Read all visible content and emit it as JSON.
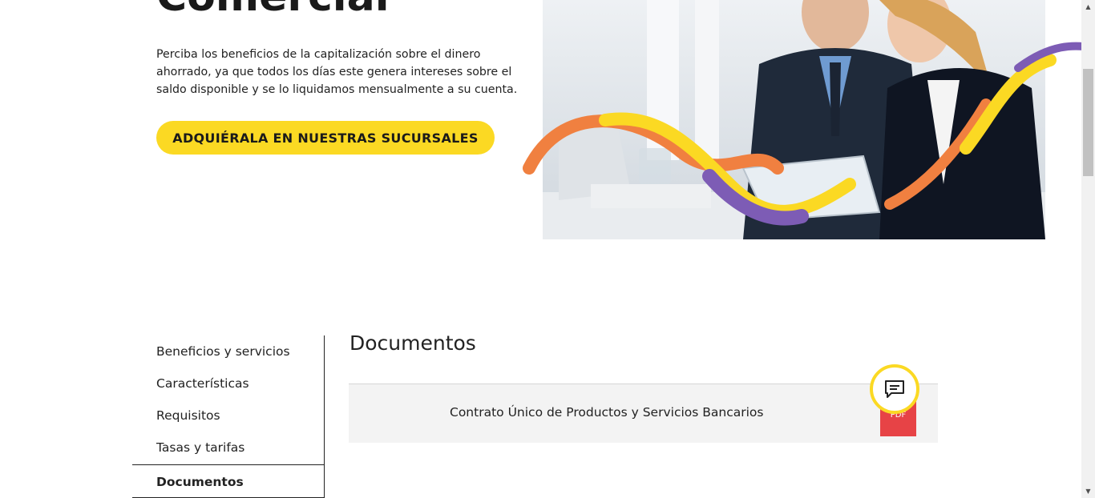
{
  "hero": {
    "title": "Comercial",
    "description": "Perciba los beneficios de la capitalización sobre el dinero ahorrado, ya que todos los días este genera intereses sobre el saldo disponible y se lo liquidamos mensualmente a su cuenta.",
    "cta_label": "ADQUIÉRALA EN NUESTRAS SUCURSALES"
  },
  "side_nav": {
    "items": [
      {
        "label": "Beneficios y servicios"
      },
      {
        "label": "Características"
      },
      {
        "label": "Requisitos"
      },
      {
        "label": "Tasas y tarifas"
      },
      {
        "label": "Documentos"
      }
    ],
    "active_index": 4
  },
  "documents": {
    "title": "Documentos",
    "items": [
      {
        "name": "Contrato Único de Productos y Servicios Bancarios",
        "badge": "PDF"
      }
    ]
  },
  "colors": {
    "accent_yellow": "#fbd923",
    "pdf_red": "#e74346",
    "wave_orange": "#f08040",
    "wave_purple": "#7d5cb5"
  },
  "icons": {
    "chat": "chat-bubble-icon"
  }
}
